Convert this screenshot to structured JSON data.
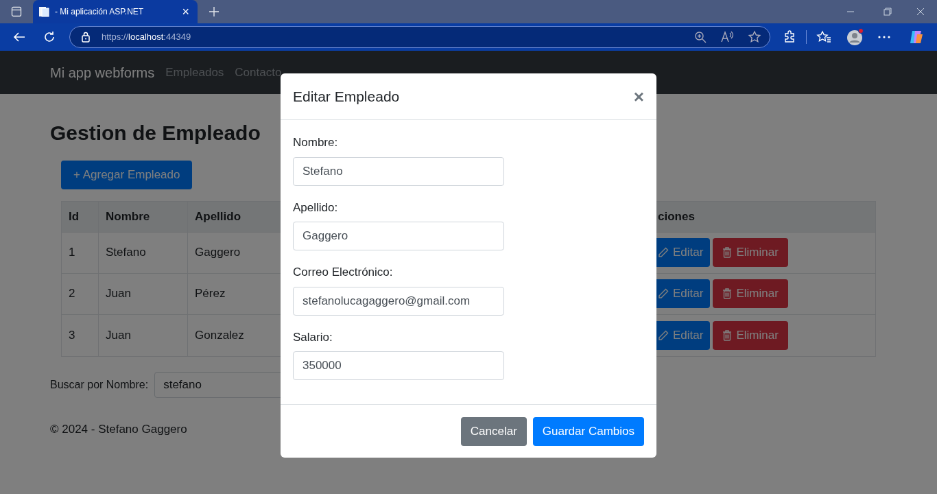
{
  "browser": {
    "tab_title": "- Mi aplicación ASP.NET",
    "tab_close": "×",
    "url_scheme": "https://",
    "url_host": "localhost",
    "url_port": ":44349"
  },
  "navbar": {
    "brand": "Mi app webforms",
    "links": [
      "Empleados",
      "Contacto"
    ]
  },
  "page": {
    "title": "Gestion de Empleado",
    "add_button": "+ Agregar Empleado",
    "table": {
      "columns": [
        "Id",
        "Nombre",
        "Apellido",
        "ciones"
      ],
      "rows": [
        {
          "id": "1",
          "nombre": "Stefano",
          "apellido": "Gaggero",
          "actions": [
            "Editar",
            "Eliminar"
          ]
        },
        {
          "id": "2",
          "nombre": "Juan",
          "apellido": "Pérez",
          "actions": [
            "Editar",
            "Eliminar"
          ]
        },
        {
          "id": "3",
          "nombre": "Juan",
          "apellido": "Gonzalez",
          "actions": [
            "Editar",
            "Eliminar"
          ]
        }
      ]
    },
    "search": {
      "label": "Buscar por Nombre:",
      "value": "stefano"
    },
    "footer": "© 2024 - Stefano Gaggero"
  },
  "modal": {
    "title": "Editar Empleado",
    "close": "×",
    "fields": [
      {
        "label": "Nombre:",
        "value": "Stefano"
      },
      {
        "label": "Apellido:",
        "value": "Gaggero"
      },
      {
        "label": "Correo Electrónico:",
        "value": "stefanolucagaggero@gmail.com"
      },
      {
        "label": "Salario:",
        "value": "350000"
      }
    ],
    "buttons": [
      {
        "label": "Cancelar",
        "kind": "secondary"
      },
      {
        "label": "Guardar Cambios",
        "kind": "primary"
      }
    ]
  }
}
